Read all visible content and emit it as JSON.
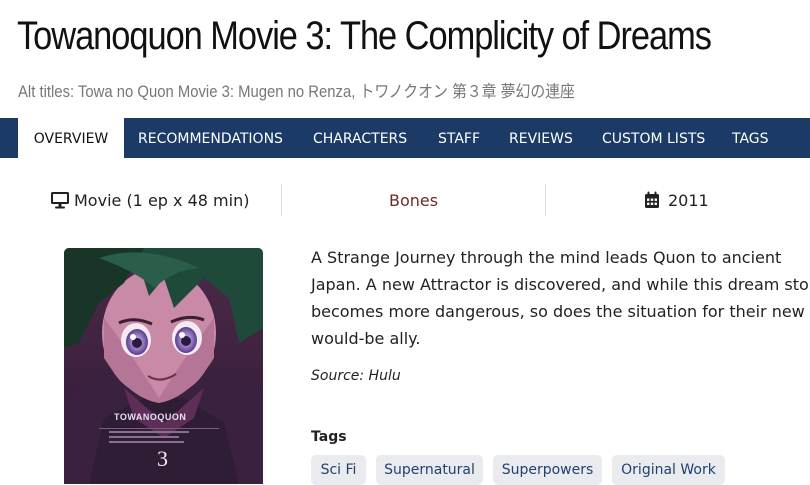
{
  "title": "Towanoquon Movie 3: The Complicity of Dreams",
  "alt_titles": {
    "prefix": "Alt titles:",
    "values": "Towa no Quon Movie 3: Mugen no Renza,",
    "japanese": "トワノクオン 第３章 夢幻の連座"
  },
  "nav": [
    "OVERVIEW",
    "RECOMMENDATIONS",
    "CHARACTERS",
    "STAFF",
    "REVIEWS",
    "CUSTOM LISTS",
    "TAGS"
  ],
  "meta": {
    "type_icon": "monitor-icon",
    "type": "Movie (1 ep x 48 min)",
    "studio": "Bones",
    "date_icon": "calendar-icon",
    "year": "2011"
  },
  "poster": {
    "logo": "TOWANOQUON",
    "number": "3"
  },
  "description": [
    "A Strange Journey through the mind leads Quon to ancient",
    "Japan. A new Attractor is discovered, and while this dream story",
    "becomes more dangerous, so does the situation for their new",
    "would-be ally."
  ],
  "source": "Source: Hulu",
  "tags_heading": "Tags",
  "tags": [
    "Sci Fi",
    "Supernatural",
    "Superpowers",
    "Original Work"
  ],
  "colors": {
    "nav_bg": "#1b3a65",
    "studio_text": "#6e2a2a",
    "tag_text": "#1f4170",
    "tag_bg": "#e9ebee"
  }
}
